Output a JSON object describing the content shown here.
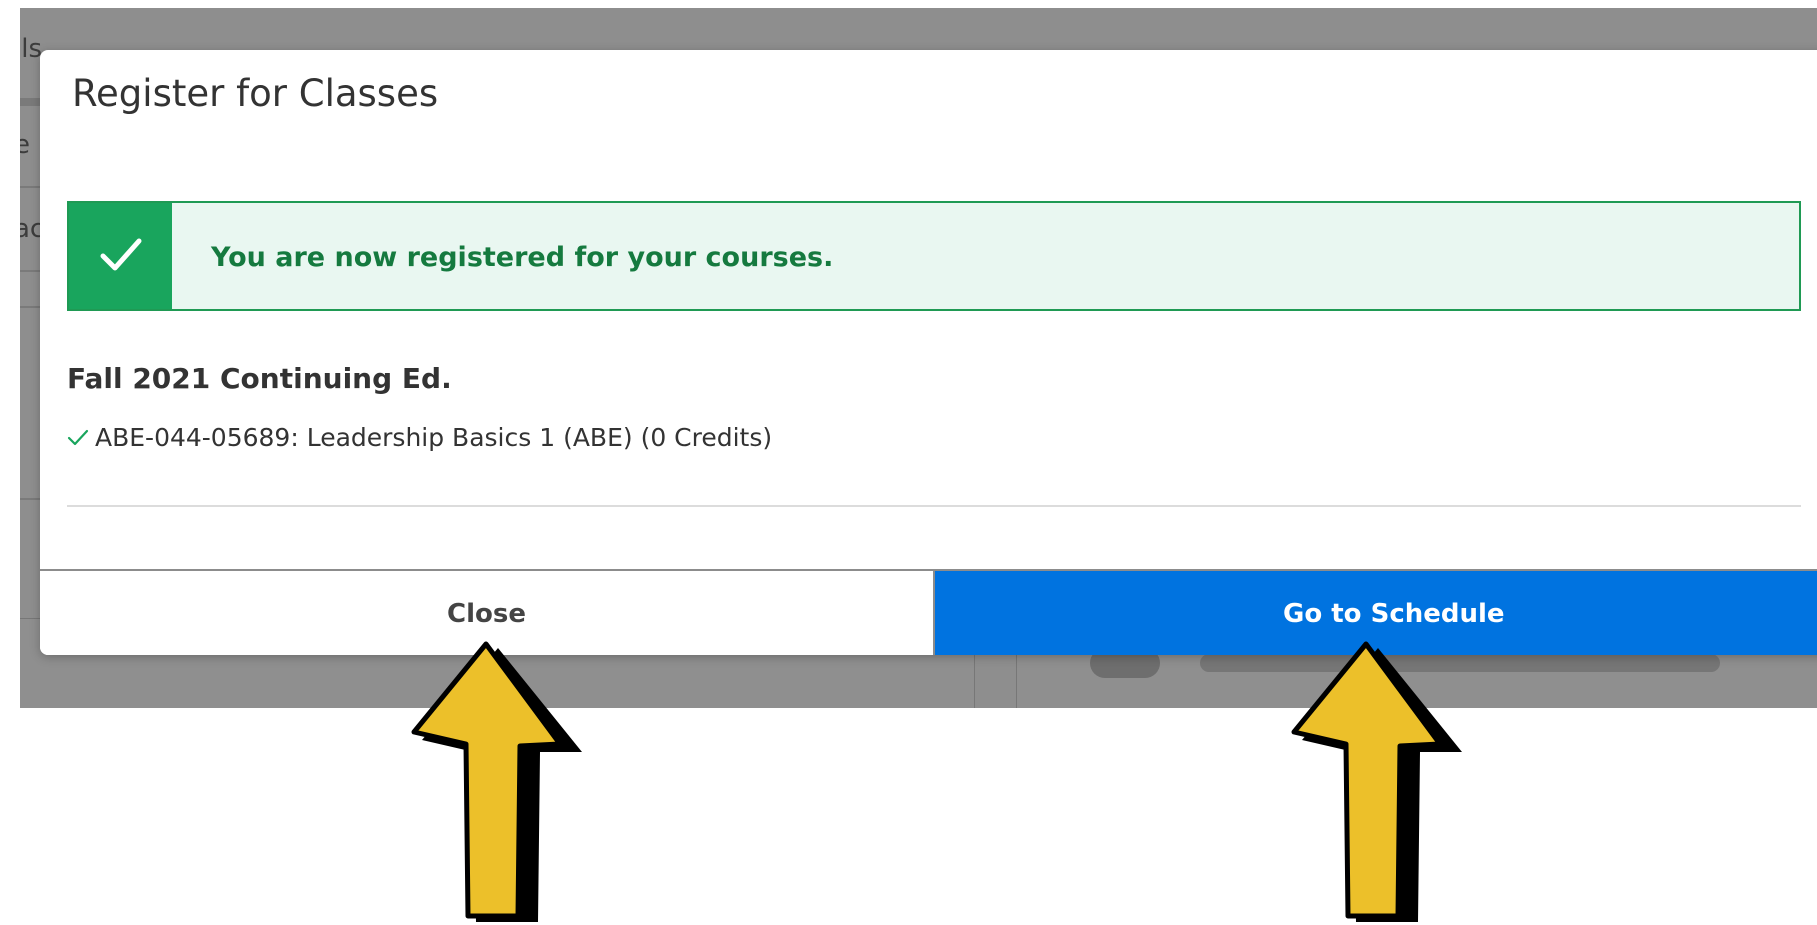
{
  "background": {
    "fragments": [
      "ils",
      "e",
      "ac"
    ]
  },
  "modal": {
    "title": "Register for Classes",
    "alert": {
      "icon": "checkmark-icon",
      "message": "You are now registered for your courses.",
      "accent_color": "#19a55d"
    },
    "term": "Fall 2021 Continuing Ed.",
    "courses": [
      {
        "status_icon": "check-icon",
        "label": "ABE-044-05689: Leadership Basics 1 (ABE) (0 Credits)"
      }
    ],
    "footer": {
      "close_label": "Close",
      "schedule_label": "Go to Schedule",
      "primary_color": "#0073e0"
    }
  },
  "annotations": {
    "arrow_color": "#ecc02a",
    "arrows": [
      "up-arrow",
      "up-arrow"
    ]
  }
}
